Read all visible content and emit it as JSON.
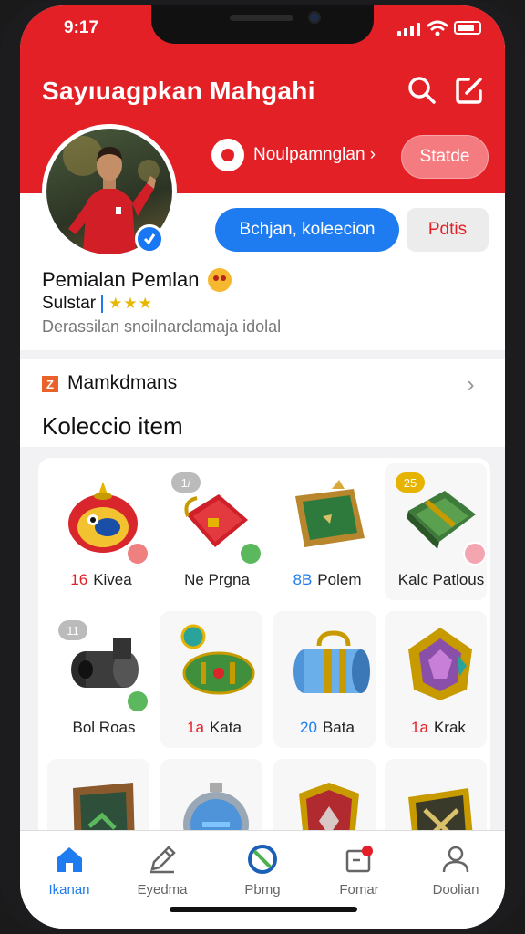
{
  "status_bar": {
    "time": "9:17"
  },
  "header": {
    "title": "Sayıuagpkan Mahgahi",
    "location_label": "Noulpamnglan ›",
    "status_button": "Statde"
  },
  "profile": {
    "primary_button": "Bchjan, koleecion",
    "secondary_button": "Pdtis",
    "name": "Pemialan Pemlan",
    "rank": "Sulstar",
    "stars": "★★★",
    "description": "Derassilan snoilnarclamaja idolal"
  },
  "collections": {
    "section_title": "Mamkdmans",
    "title": "Koleccio item"
  },
  "items": [
    {
      "count": "16",
      "name": "Kivea",
      "badge": ""
    },
    {
      "count": "",
      "name": "Ne Prgna",
      "badge": "1/"
    },
    {
      "count": "8B",
      "name": "Polem",
      "badge": ""
    },
    {
      "count": "",
      "name": "Kalc Patlous",
      "badge": "25"
    },
    {
      "count": "",
      "name": "Bol Roas",
      "badge": "11"
    },
    {
      "count": "1a",
      "name": "Kata",
      "badge": ""
    },
    {
      "count": "20",
      "name": "Bata",
      "badge": ""
    },
    {
      "count": "1a",
      "name": "Krak",
      "badge": ""
    }
  ],
  "tabs": [
    {
      "label": "Ikanan",
      "icon": "home-icon"
    },
    {
      "label": "Eyedma",
      "icon": "edit-icon"
    },
    {
      "label": "Pbmg",
      "icon": "circle-slash-icon"
    },
    {
      "label": "Fomar",
      "icon": "notification-icon"
    },
    {
      "label": "Doolian",
      "icon": "profile-icon"
    }
  ],
  "colors": {
    "brand_red": "#e42027",
    "accent_blue": "#1e7cf0"
  }
}
